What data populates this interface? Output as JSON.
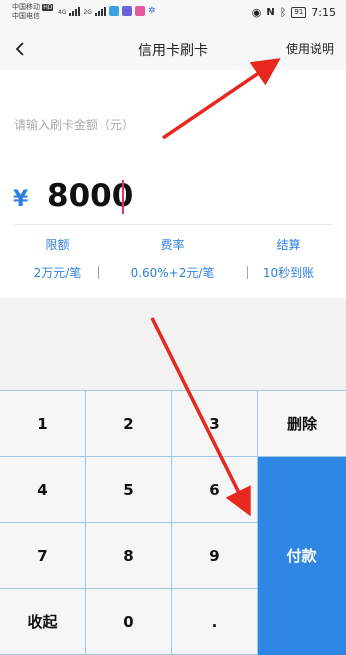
{
  "status_bar": {
    "carrier_line1": "中国移动",
    "carrier_line2": "中国电信",
    "network_label": "HD",
    "network_type_1": "4G",
    "network_type_2": "2G",
    "battery": "91",
    "time": "7:15"
  },
  "header": {
    "title": "信用卡刷卡",
    "help_link": "使用说明"
  },
  "amount": {
    "placeholder": "请输入刷卡金额（元）",
    "currency_symbol": "¥",
    "value": "8000"
  },
  "info": [
    {
      "label": "限额",
      "value": "2万元/笔"
    },
    {
      "label": "费率",
      "value": "0.60%+2元/笔"
    },
    {
      "label": "结算",
      "value": "10秒到账"
    }
  ],
  "keypad": {
    "keys": [
      "1",
      "2",
      "3",
      "4",
      "5",
      "6",
      "7",
      "8",
      "9",
      "收起",
      "0",
      "."
    ],
    "delete_label": "删除",
    "pay_label": "付款"
  },
  "colors": {
    "accent": "#2f86e3",
    "arrow": "#e8271f"
  }
}
